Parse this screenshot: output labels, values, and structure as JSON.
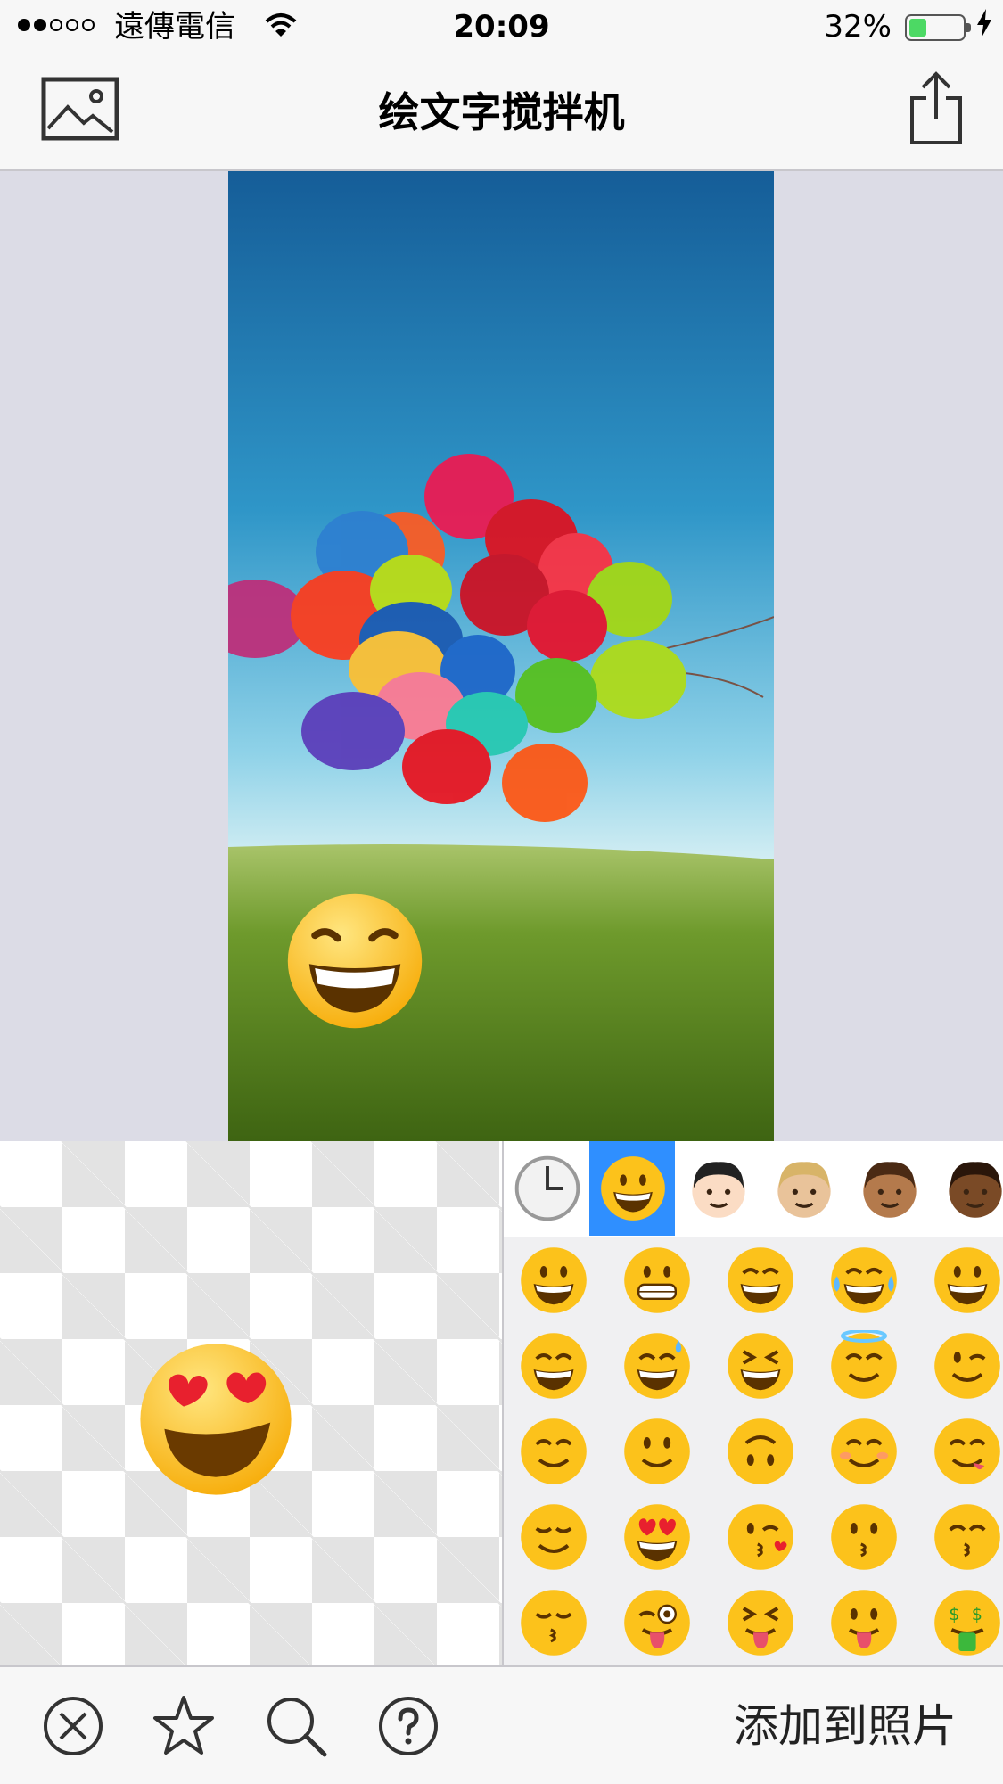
{
  "status_bar": {
    "carrier": "遠傳電信",
    "time": "20:09",
    "battery_percent": "32%",
    "battery_level": 0.32,
    "signal_bars_filled": 2,
    "signal_bars_total": 5
  },
  "nav": {
    "title": "绘文字搅拌机",
    "left_icon": "photo-library-icon",
    "right_icon": "share-icon"
  },
  "picker": {
    "categories": [
      "recent-clock-icon",
      "smileys-icon",
      "person-light-icon",
      "person-medium-light-icon",
      "person-medium-dark-icon",
      "person-dark-icon"
    ],
    "selected_category": 1,
    "emoji_rows": [
      [
        "😀",
        "😬",
        "😁",
        "😂",
        "😃"
      ],
      [
        "😄",
        "😅",
        "😆",
        "😇",
        "😉"
      ],
      [
        "😊",
        "🙂",
        "🙃",
        "☺️",
        "😋"
      ],
      [
        "😌",
        "😍",
        "😘",
        "😗",
        "😙"
      ],
      [
        "😚",
        "😜",
        "😝",
        "😛",
        "🤑"
      ]
    ]
  },
  "canvas": {
    "sticker": "😄",
    "preview": "😍"
  },
  "toolbar": {
    "icons": [
      "clear-icon",
      "favorite-star-icon",
      "search-icon",
      "help-icon"
    ],
    "add_label": "添加到照片"
  },
  "colors": {
    "accent": "#2f8fff",
    "bar_background": "#f7f7f7",
    "canvas_background": "#dcdce6",
    "battery_green": "#4cd964"
  }
}
